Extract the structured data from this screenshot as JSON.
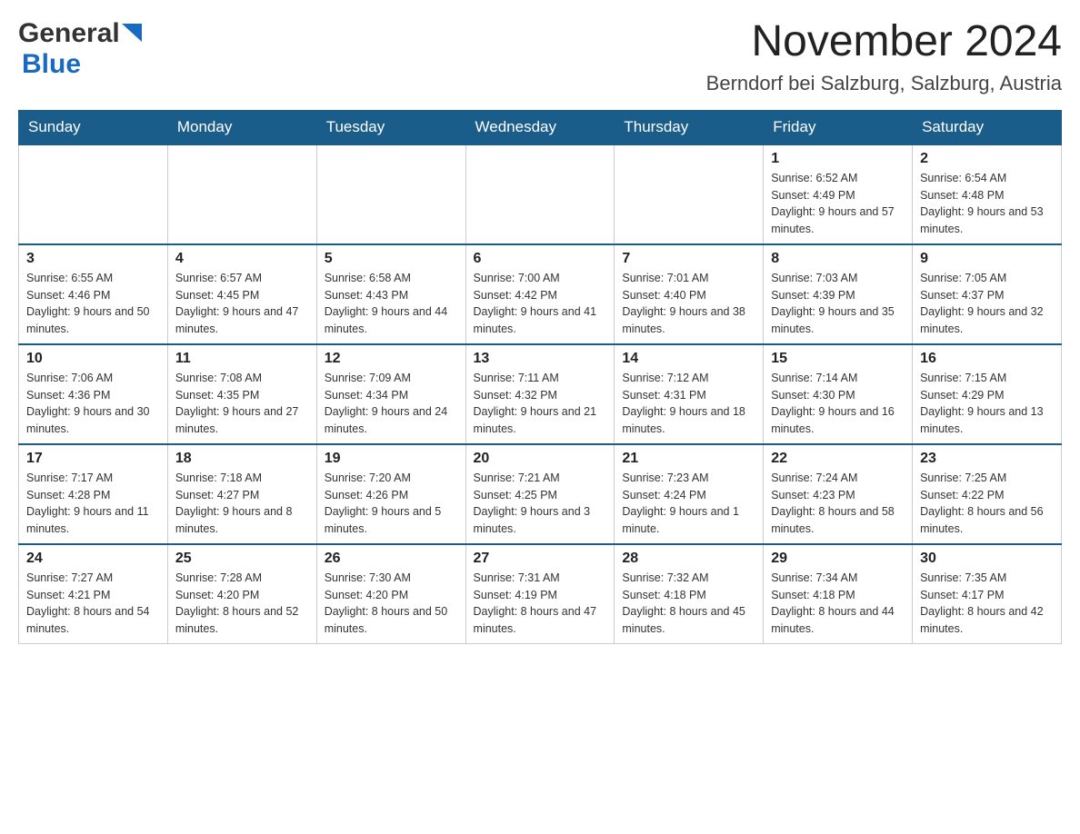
{
  "header": {
    "logo_general": "General",
    "logo_blue": "Blue",
    "month_year": "November 2024",
    "location": "Berndorf bei Salzburg, Salzburg, Austria"
  },
  "weekdays": [
    "Sunday",
    "Monday",
    "Tuesday",
    "Wednesday",
    "Thursday",
    "Friday",
    "Saturday"
  ],
  "weeks": [
    [
      {
        "day": "",
        "sunrise": "",
        "sunset": "",
        "daylight": ""
      },
      {
        "day": "",
        "sunrise": "",
        "sunset": "",
        "daylight": ""
      },
      {
        "day": "",
        "sunrise": "",
        "sunset": "",
        "daylight": ""
      },
      {
        "day": "",
        "sunrise": "",
        "sunset": "",
        "daylight": ""
      },
      {
        "day": "",
        "sunrise": "",
        "sunset": "",
        "daylight": ""
      },
      {
        "day": "1",
        "sunrise": "Sunrise: 6:52 AM",
        "sunset": "Sunset: 4:49 PM",
        "daylight": "Daylight: 9 hours and 57 minutes."
      },
      {
        "day": "2",
        "sunrise": "Sunrise: 6:54 AM",
        "sunset": "Sunset: 4:48 PM",
        "daylight": "Daylight: 9 hours and 53 minutes."
      }
    ],
    [
      {
        "day": "3",
        "sunrise": "Sunrise: 6:55 AM",
        "sunset": "Sunset: 4:46 PM",
        "daylight": "Daylight: 9 hours and 50 minutes."
      },
      {
        "day": "4",
        "sunrise": "Sunrise: 6:57 AM",
        "sunset": "Sunset: 4:45 PM",
        "daylight": "Daylight: 9 hours and 47 minutes."
      },
      {
        "day": "5",
        "sunrise": "Sunrise: 6:58 AM",
        "sunset": "Sunset: 4:43 PM",
        "daylight": "Daylight: 9 hours and 44 minutes."
      },
      {
        "day": "6",
        "sunrise": "Sunrise: 7:00 AM",
        "sunset": "Sunset: 4:42 PM",
        "daylight": "Daylight: 9 hours and 41 minutes."
      },
      {
        "day": "7",
        "sunrise": "Sunrise: 7:01 AM",
        "sunset": "Sunset: 4:40 PM",
        "daylight": "Daylight: 9 hours and 38 minutes."
      },
      {
        "day": "8",
        "sunrise": "Sunrise: 7:03 AM",
        "sunset": "Sunset: 4:39 PM",
        "daylight": "Daylight: 9 hours and 35 minutes."
      },
      {
        "day": "9",
        "sunrise": "Sunrise: 7:05 AM",
        "sunset": "Sunset: 4:37 PM",
        "daylight": "Daylight: 9 hours and 32 minutes."
      }
    ],
    [
      {
        "day": "10",
        "sunrise": "Sunrise: 7:06 AM",
        "sunset": "Sunset: 4:36 PM",
        "daylight": "Daylight: 9 hours and 30 minutes."
      },
      {
        "day": "11",
        "sunrise": "Sunrise: 7:08 AM",
        "sunset": "Sunset: 4:35 PM",
        "daylight": "Daylight: 9 hours and 27 minutes."
      },
      {
        "day": "12",
        "sunrise": "Sunrise: 7:09 AM",
        "sunset": "Sunset: 4:34 PM",
        "daylight": "Daylight: 9 hours and 24 minutes."
      },
      {
        "day": "13",
        "sunrise": "Sunrise: 7:11 AM",
        "sunset": "Sunset: 4:32 PM",
        "daylight": "Daylight: 9 hours and 21 minutes."
      },
      {
        "day": "14",
        "sunrise": "Sunrise: 7:12 AM",
        "sunset": "Sunset: 4:31 PM",
        "daylight": "Daylight: 9 hours and 18 minutes."
      },
      {
        "day": "15",
        "sunrise": "Sunrise: 7:14 AM",
        "sunset": "Sunset: 4:30 PM",
        "daylight": "Daylight: 9 hours and 16 minutes."
      },
      {
        "day": "16",
        "sunrise": "Sunrise: 7:15 AM",
        "sunset": "Sunset: 4:29 PM",
        "daylight": "Daylight: 9 hours and 13 minutes."
      }
    ],
    [
      {
        "day": "17",
        "sunrise": "Sunrise: 7:17 AM",
        "sunset": "Sunset: 4:28 PM",
        "daylight": "Daylight: 9 hours and 11 minutes."
      },
      {
        "day": "18",
        "sunrise": "Sunrise: 7:18 AM",
        "sunset": "Sunset: 4:27 PM",
        "daylight": "Daylight: 9 hours and 8 minutes."
      },
      {
        "day": "19",
        "sunrise": "Sunrise: 7:20 AM",
        "sunset": "Sunset: 4:26 PM",
        "daylight": "Daylight: 9 hours and 5 minutes."
      },
      {
        "day": "20",
        "sunrise": "Sunrise: 7:21 AM",
        "sunset": "Sunset: 4:25 PM",
        "daylight": "Daylight: 9 hours and 3 minutes."
      },
      {
        "day": "21",
        "sunrise": "Sunrise: 7:23 AM",
        "sunset": "Sunset: 4:24 PM",
        "daylight": "Daylight: 9 hours and 1 minute."
      },
      {
        "day": "22",
        "sunrise": "Sunrise: 7:24 AM",
        "sunset": "Sunset: 4:23 PM",
        "daylight": "Daylight: 8 hours and 58 minutes."
      },
      {
        "day": "23",
        "sunrise": "Sunrise: 7:25 AM",
        "sunset": "Sunset: 4:22 PM",
        "daylight": "Daylight: 8 hours and 56 minutes."
      }
    ],
    [
      {
        "day": "24",
        "sunrise": "Sunrise: 7:27 AM",
        "sunset": "Sunset: 4:21 PM",
        "daylight": "Daylight: 8 hours and 54 minutes."
      },
      {
        "day": "25",
        "sunrise": "Sunrise: 7:28 AM",
        "sunset": "Sunset: 4:20 PM",
        "daylight": "Daylight: 8 hours and 52 minutes."
      },
      {
        "day": "26",
        "sunrise": "Sunrise: 7:30 AM",
        "sunset": "Sunset: 4:20 PM",
        "daylight": "Daylight: 8 hours and 50 minutes."
      },
      {
        "day": "27",
        "sunrise": "Sunrise: 7:31 AM",
        "sunset": "Sunset: 4:19 PM",
        "daylight": "Daylight: 8 hours and 47 minutes."
      },
      {
        "day": "28",
        "sunrise": "Sunrise: 7:32 AM",
        "sunset": "Sunset: 4:18 PM",
        "daylight": "Daylight: 8 hours and 45 minutes."
      },
      {
        "day": "29",
        "sunrise": "Sunrise: 7:34 AM",
        "sunset": "Sunset: 4:18 PM",
        "daylight": "Daylight: 8 hours and 44 minutes."
      },
      {
        "day": "30",
        "sunrise": "Sunrise: 7:35 AM",
        "sunset": "Sunset: 4:17 PM",
        "daylight": "Daylight: 8 hours and 42 minutes."
      }
    ]
  ]
}
